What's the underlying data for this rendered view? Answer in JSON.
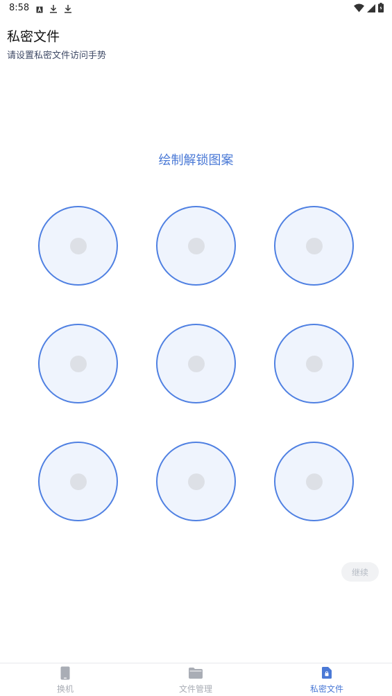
{
  "status_bar": {
    "time": "8:58",
    "left_icons": [
      "a-box-icon",
      "download-icon",
      "download-icon"
    ],
    "right_icons": [
      "wifi-icon",
      "signal-icon",
      "battery-icon"
    ]
  },
  "header": {
    "title": "私密文件",
    "subtitle": "请设置私密文件访问手势"
  },
  "pattern": {
    "prompt": "绘制解锁图案",
    "rows": 3,
    "cols": 3,
    "colors": {
      "ring": "#4f80e2",
      "fill": "#eff4fd",
      "center": "#dde0e6"
    }
  },
  "continue_button": {
    "label": "继续"
  },
  "bottom_nav": {
    "items": [
      {
        "label": "换机",
        "icon": "phone-icon",
        "active": false
      },
      {
        "label": "文件管理",
        "icon": "folder-icon",
        "active": false
      },
      {
        "label": "私密文件",
        "icon": "locked-file-icon",
        "active": true
      }
    ]
  },
  "accent_color": "#4a79d6"
}
